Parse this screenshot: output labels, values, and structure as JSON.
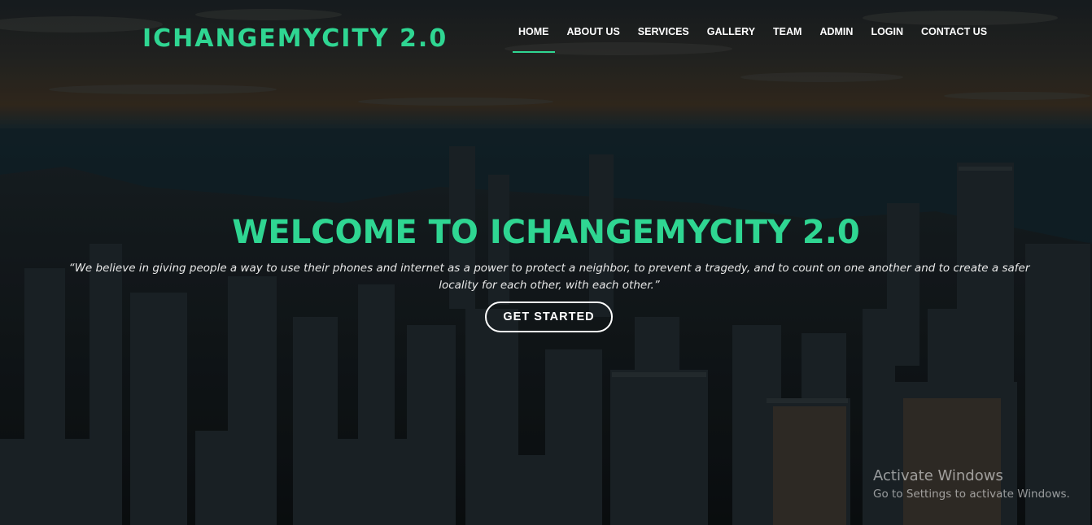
{
  "header": {
    "logo": "ICHANGEMYCITY 2.0",
    "nav": [
      {
        "label": "HOME",
        "active": true
      },
      {
        "label": "ABOUT US",
        "active": false
      },
      {
        "label": "SERVICES",
        "active": false
      },
      {
        "label": "GALLERY",
        "active": false
      },
      {
        "label": "TEAM",
        "active": false
      },
      {
        "label": "ADMIN",
        "active": false
      },
      {
        "label": "LOGIN",
        "active": false
      },
      {
        "label": "CONTACT US",
        "active": false
      }
    ]
  },
  "hero": {
    "title": "WELCOME TO ICHANGEMYCITY 2.0",
    "quote": "“We believe in giving people a way to use their phones and internet as a power to protect a neighbor, to prevent a tragedy, and to count on one another and to create a safer locality for each other, with each other.”",
    "cta_label": "GET STARTED",
    "background_image": "city-skyline-aerial"
  },
  "watermark": {
    "title": "Activate Windows",
    "subtitle": "Go to Settings to activate Windows."
  },
  "colors": {
    "accent": "#2fd692",
    "text": "#ffffff"
  }
}
